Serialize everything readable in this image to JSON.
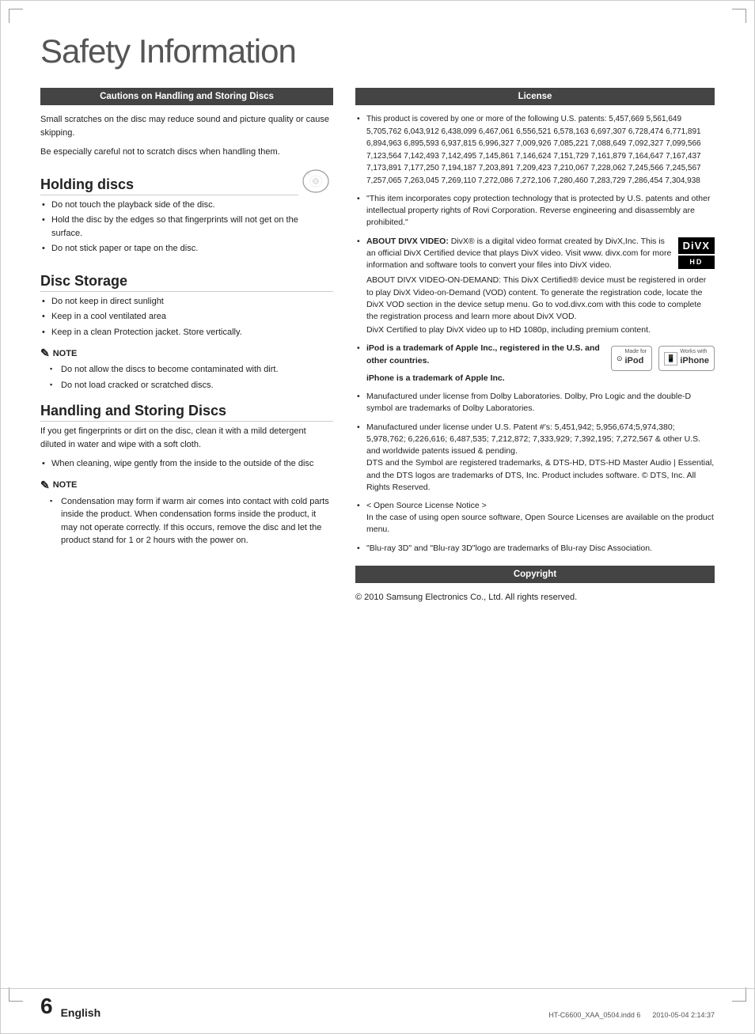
{
  "page": {
    "title": "Safety Information",
    "footer": {
      "page_number": "6",
      "language": "English",
      "file_info": "HT-C6600_XAA_0504.indd   6",
      "date_info": "2010-05-04   2:14:37"
    }
  },
  "left": {
    "cautions_header": "Cautions on Handling and Storing Discs",
    "cautions_intro1": "Small scratches on the disc may reduce sound and picture quality or cause skipping.",
    "cautions_intro2": "Be especially careful not to scratch discs when handling them.",
    "holding_discs": {
      "title": "Holding discs",
      "bullets": [
        "Do not touch the playback side of the disc.",
        "Hold the disc by the edges so that fingerprints will not get on the surface.",
        "Do not stick paper or tape on the disc."
      ]
    },
    "disc_storage": {
      "title": "Disc Storage",
      "bullets": [
        "Do not keep in direct sunlight",
        "Keep in a cool ventilated area",
        "Keep in a clean Protection jacket. Store vertically."
      ],
      "note_label": "NOTE",
      "notes": [
        "Do not allow the discs to become contaminated with dirt.",
        "Do not load cracked or scratched discs."
      ]
    },
    "handling": {
      "title": "Handling and Storing Discs",
      "intro": "If you get fingerprints or dirt on the disc, clean it with a mild detergent diluted in water and wipe with a soft cloth.",
      "bullets": [
        "When cleaning, wipe gently from the inside to the outside of the disc"
      ],
      "note_label": "NOTE",
      "notes": [
        "Condensation may form if warm air comes into contact with cold parts inside the product. When condensation forms inside the product, it may not operate correctly. If this occurs, remove the disc and let the product stand for 1 or 2 hours with the power on."
      ]
    }
  },
  "right": {
    "license_header": "License",
    "license_bullets": [
      {
        "id": "patents",
        "text": "This product is covered by one or more of the following U.S. patents: 5,457,669 5,561,649 5,705,762 6,043,912 6,438,099 6,467,061 6,556,521 6,578,163 6,697,307 6,728,474 6,771,891 6,894,963 6,895,593 6,937,815 6,996,327 7,009,926 7,085,221 7,088,649 7,092,327 7,099,566 7,123,564 7,142,493 7,142,495 7,145,861 7,146,624 7,151,729 7,161,879 7,164,647 7,167,437 7,173,891 7,177,250 7,194,187 7,203,891 7,209,423 7,210,067 7,228,062 7,245,566 7,245,567 7,257,065 7,263,045 7,269,110 7,272,086 7,272,106 7,280,460 7,283,729 7,286,454 7,304,938"
      },
      {
        "id": "copy-protection",
        "text": "\"This item incorporates copy protection technology that is protected by U.S. patents and other intellectual property rights of Rovi Corporation. Reverse engineering and disassembly are prohibited.\""
      },
      {
        "id": "divx",
        "text_bold": "ABOUT DIVX VIDEO:",
        "text": "DivX® is a digital video format created by DivX,Inc. This is an official DivX Certified device that plays DivX video. Visit www. divx.com for more information and software tools to convert your files into DivX video.",
        "text2": "ABOUT DIVX VIDEO-ON-DEMAND: This DivX Certified® device must be registered in order to play DivX Video-on-Demand (VOD) content. To generate the registration code, locate the DivX VOD section in the device setup menu. Go to vod.divx.com with this code to complete the registration process and learn more about DivX VOD.",
        "text3": "DivX Certified to play DivX video up to HD 1080p, including premium content.",
        "logo_divx": "DivX",
        "logo_hd": "HD"
      },
      {
        "id": "ipod",
        "text_bold": "iPod is a trademark of Apple Inc., registered in the U.S. and other countries.",
        "text2": "iPhone is a trademark of Apple Inc.",
        "made_for": "Made for",
        "ipod_name": "iPod",
        "works_with": "Works with",
        "iphone_name": "iPhone"
      },
      {
        "id": "dolby",
        "text": "Manufactured under license from Dolby Laboratories. Dolby, Pro Logic and the double-D symbol are trademarks of Dolby Laboratories."
      },
      {
        "id": "dts",
        "text": "Manufactured under license under U.S. Patent #'s: 5,451,942; 5,956,674;5,974,380; 5,978,762; 6,226,616; 6,487,535; 7,212,872; 7,333,929; 7,392,195; 7,272,567 & other U.S. and worldwide patents issued & pending.\nDTS and the Symbol are registered trademarks, & DTS-HD, DTS-HD Master Audio | Essential, and the DTS logos are trademarks of DTS, Inc. Product includes software. © DTS, Inc. All Rights Reserved."
      },
      {
        "id": "open-source",
        "text": "< Open Source License Notice >\nIn the case of using open source software, Open Source Licenses are available on the product menu."
      },
      {
        "id": "bluray",
        "text": "\"Blu-ray 3D\" and \"Blu-ray 3D\"logo are trademarks of Blu-ray Disc Association."
      }
    ],
    "copyright_header": "Copyright",
    "copyright_text": "© 2010 Samsung Electronics Co., Ltd. All rights reserved."
  }
}
